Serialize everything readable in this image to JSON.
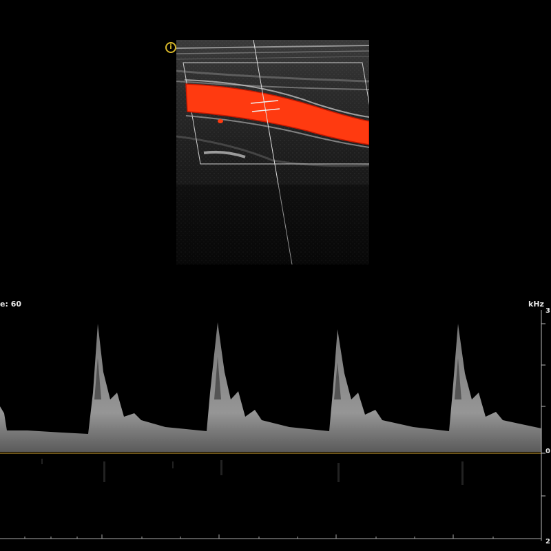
{
  "bmode": {
    "probe_marker_icon": "probe-orientation-icon"
  },
  "spectral": {
    "label_left": "e: 60",
    "unit_label": "kHz",
    "scale_top": "3",
    "scale_zero": "0",
    "scale_bottom": "2"
  },
  "colors": {
    "flow": "#ff3a10",
    "flow_edge": "#c81800",
    "baseline": "#6b5318",
    "probe_marker": "#d8b82a"
  }
}
